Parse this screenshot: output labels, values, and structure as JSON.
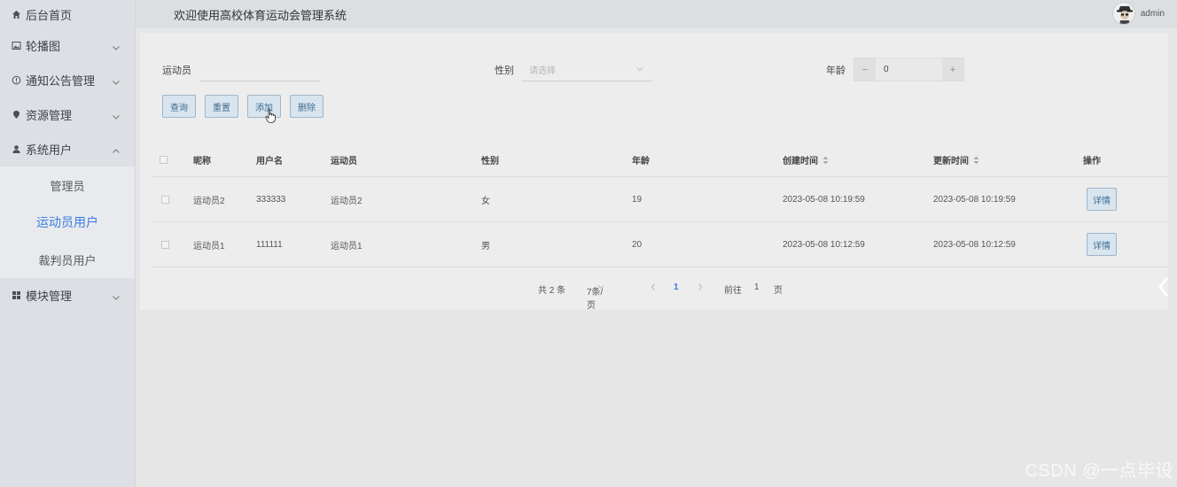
{
  "sidebar": {
    "items": [
      {
        "label": "后台首页",
        "icon": "home-icon"
      },
      {
        "label": "轮播图",
        "icon": "image-icon"
      },
      {
        "label": "通知公告管理",
        "icon": "info-icon"
      },
      {
        "label": "资源管理",
        "icon": "location-icon"
      },
      {
        "label": "系统用户",
        "icon": "user-icon"
      },
      {
        "label": "模块管理",
        "icon": "grid-icon"
      }
    ],
    "submenu": [
      {
        "label": "管理员"
      },
      {
        "label": "运动员用户"
      },
      {
        "label": "裁判员用户"
      }
    ]
  },
  "header": {
    "title": "欢迎使用高校体育运动会管理系统",
    "username": "admin"
  },
  "search": {
    "athlete_label": "运动员",
    "athlete_value": "",
    "gender_label": "性别",
    "gender_placeholder": "请选择",
    "age_label": "年龄",
    "age_value": "0",
    "minus": "−",
    "plus": "+"
  },
  "actions": {
    "query": "查询",
    "reset": "重置",
    "add": "添加",
    "delete": "删除"
  },
  "table": {
    "columns": [
      "昵称",
      "用户名",
      "运动员",
      "性别",
      "年龄",
      "创建时间",
      "更新时间",
      "操作"
    ],
    "rows": [
      {
        "nickname": "运动员2",
        "username": "333333",
        "athlete": "运动员2",
        "gender": "女",
        "age": "19",
        "created": "2023-05-08 10:19:59",
        "updated": "2023-05-08 10:19:59",
        "action": "详情"
      },
      {
        "nickname": "运动员1",
        "username": "111111",
        "athlete": "运动员1",
        "gender": "男",
        "age": "20",
        "created": "2023-05-08 10:12:59",
        "updated": "2023-05-08 10:12:59",
        "action": "详情"
      }
    ]
  },
  "pagination": {
    "total": "共 2 条",
    "page_size": "7条/页",
    "current_page": "1",
    "goto_label": "前往",
    "goto_value": "1",
    "page_suffix": "页"
  },
  "watermark": "CSDN @一点毕设",
  "colors": {
    "accent": "#3b7be0",
    "button_bg": "#d8e4ee",
    "button_border": "#9fb6c9"
  }
}
